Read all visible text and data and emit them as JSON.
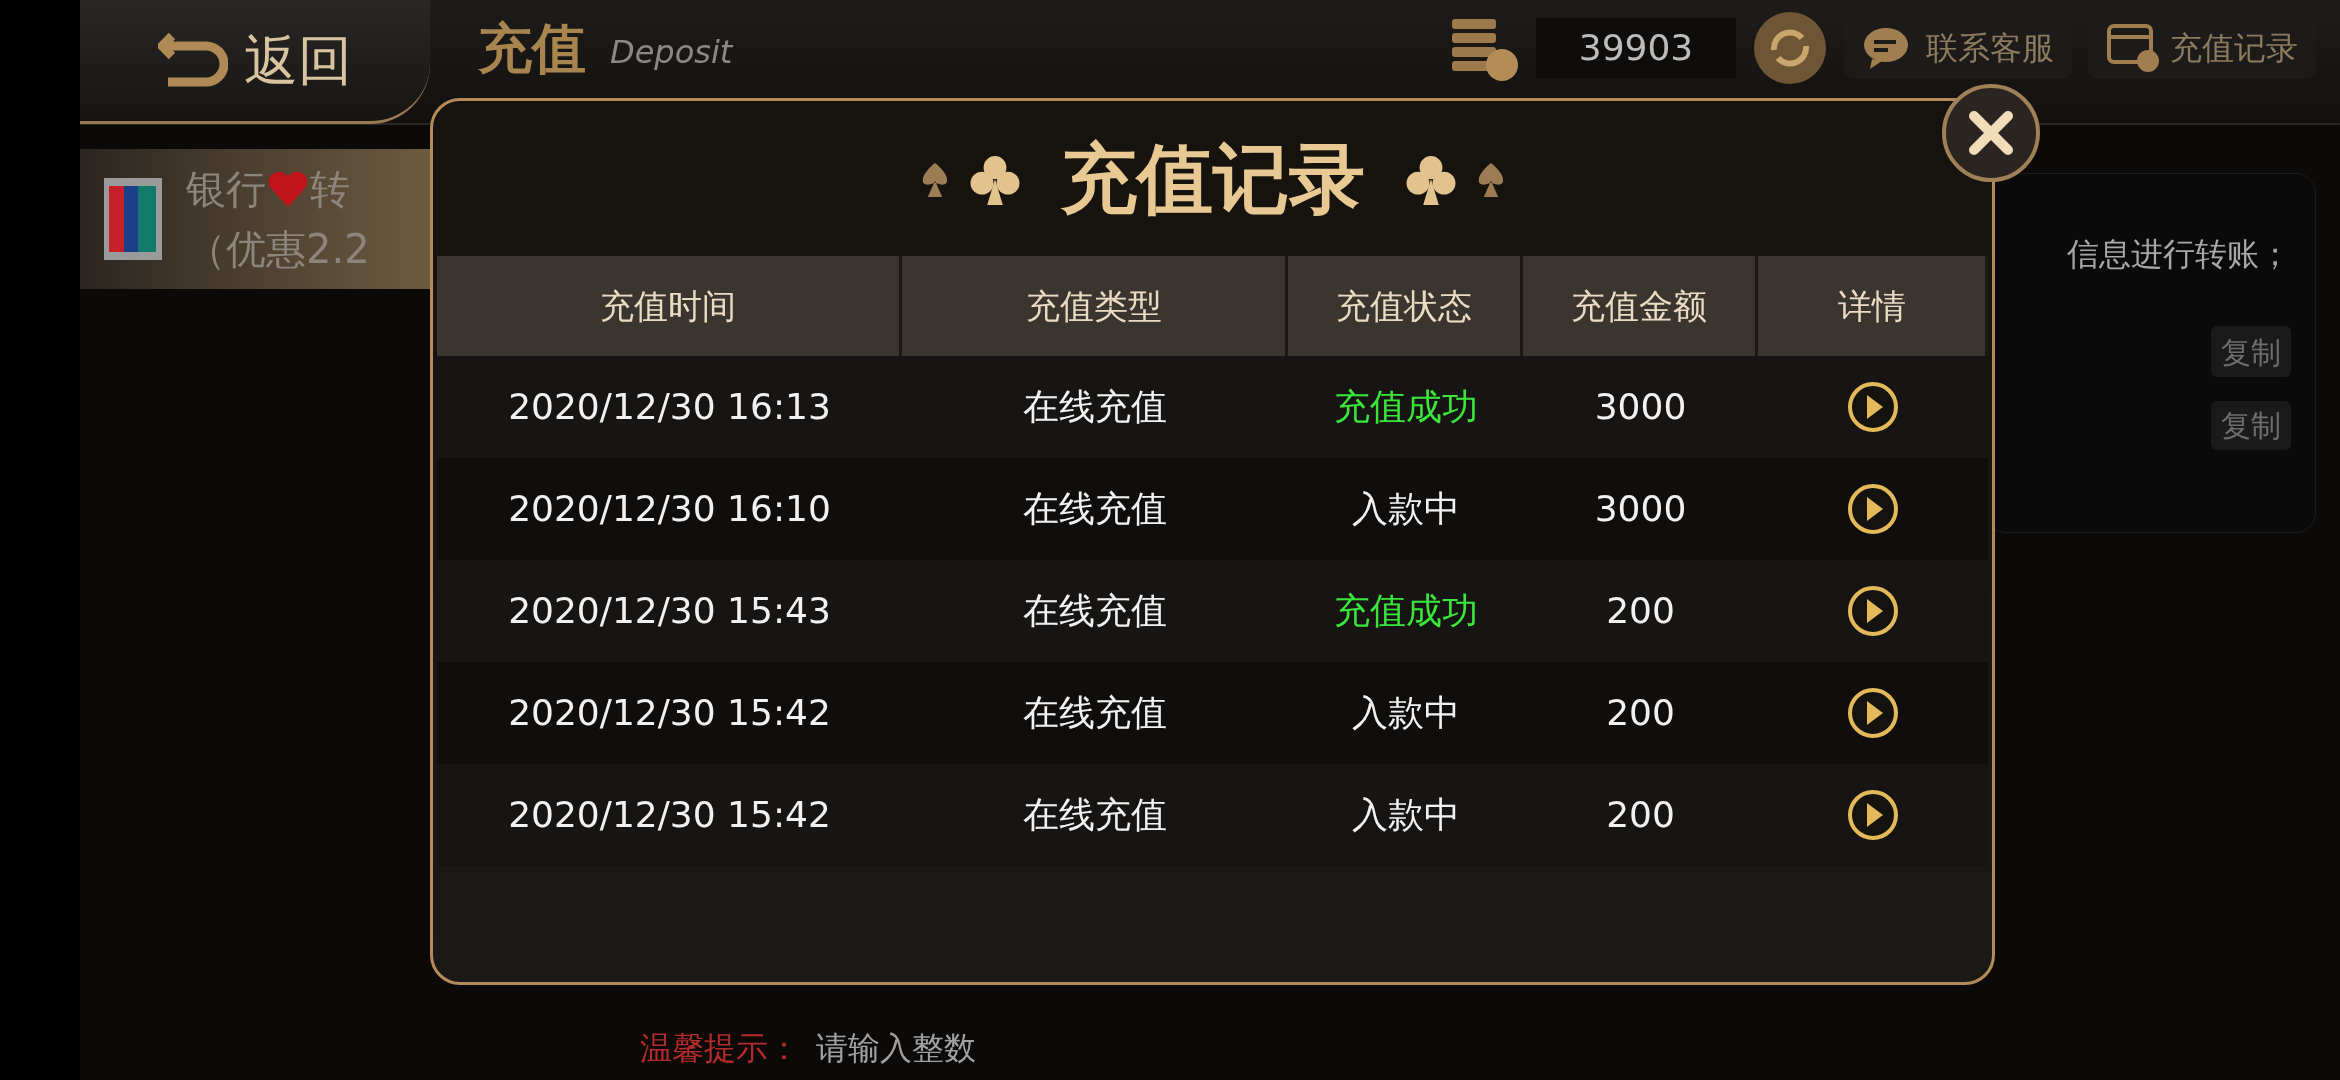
{
  "header": {
    "back": "返回",
    "title": "充值",
    "subtitle": "Deposit",
    "balance": "39903",
    "buttons": [
      {
        "kind": "chat",
        "label": "联系客服"
      },
      {
        "kind": "record",
        "label": "充值记录"
      }
    ]
  },
  "sidebar": {
    "items": [
      {
        "title_start": "银行",
        "title_end": "转",
        "subtitle": "（优惠2.2",
        "selected": true
      }
    ]
  },
  "panel": {
    "text": "信息进行转账；",
    "buttons": [
      "复制",
      "复制"
    ]
  },
  "hint": {
    "label": "温馨提示：",
    "text": "请输入整数"
  },
  "dialog": {
    "title": "充值记录",
    "columns": [
      "充值时间",
      "充值类型",
      "充值状态",
      "充值金额",
      "详情"
    ],
    "rows": [
      {
        "time": "2020/12/30 16:13",
        "type": "在线充值",
        "status": "充值成功",
        "success": true,
        "amount": "3000"
      },
      {
        "time": "2020/12/30 16:10",
        "type": "在线充值",
        "status": "入款中",
        "success": false,
        "amount": "3000"
      },
      {
        "time": "2020/12/30 15:43",
        "type": "在线充值",
        "status": "充值成功",
        "success": true,
        "amount": "200"
      },
      {
        "time": "2020/12/30 15:42",
        "type": "在线充值",
        "status": "入款中",
        "success": false,
        "amount": "200"
      },
      {
        "time": "2020/12/30 15:42",
        "type": "在线充值",
        "status": "入款中",
        "success": false,
        "amount": "200"
      }
    ]
  }
}
